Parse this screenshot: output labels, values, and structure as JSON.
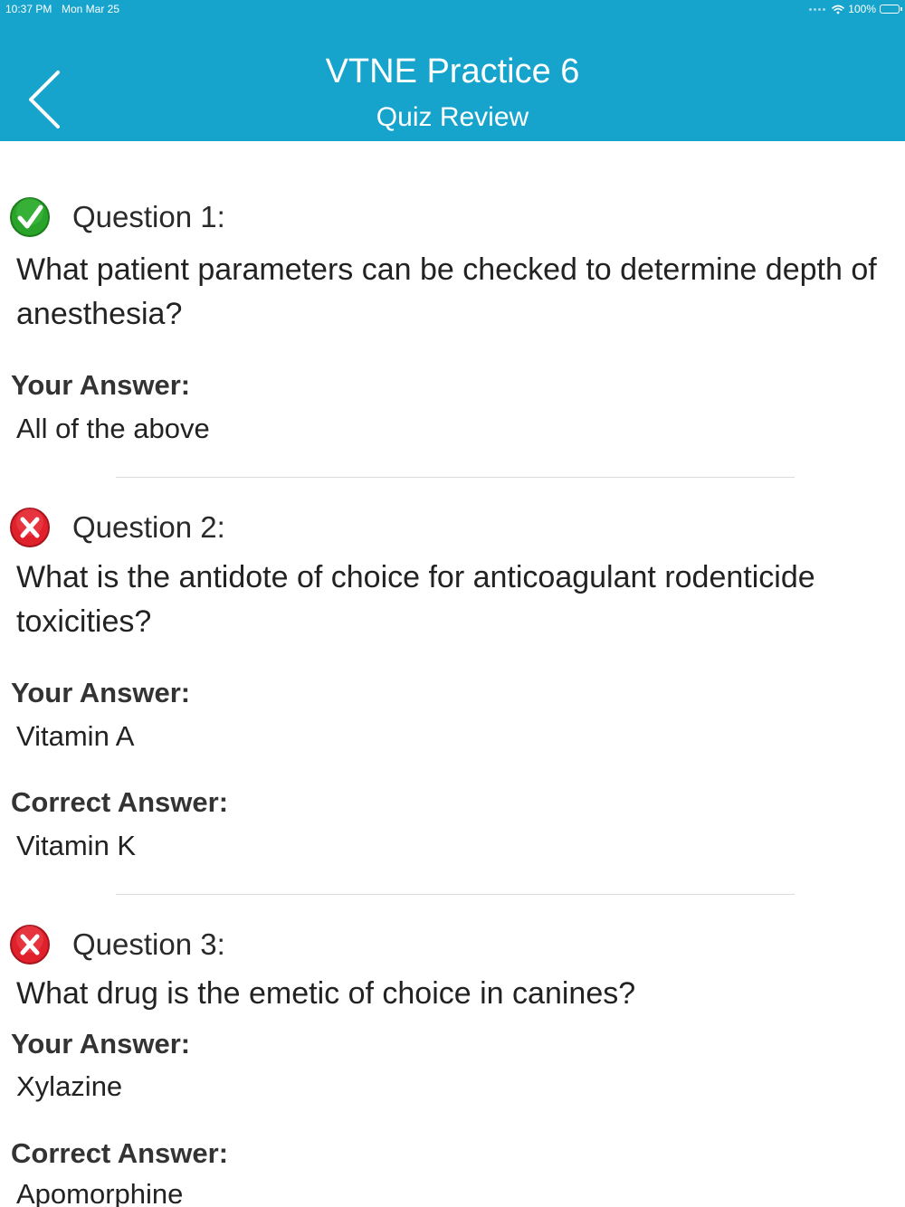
{
  "status_bar": {
    "time": "10:37 PM",
    "date": "Mon Mar 25",
    "battery": "100%",
    "battery_level": 1.0,
    "wifi_icon": "wifi-icon",
    "battery_icon": "battery-icon"
  },
  "nav": {
    "title": "VTNE Practice 6",
    "subtitle": "Quiz Review",
    "back_icon": "chevron-left-icon"
  },
  "colors": {
    "header": "#16a4cc",
    "correct": "#2aa32a",
    "incorrect": "#e0202b"
  },
  "questions": [
    {
      "label": "Question 1:",
      "status": "correct",
      "text": "What patient parameters can be checked to determine depth of anesthesia?",
      "your_answer_label": "Your Answer:",
      "your_answer": "All of the above"
    },
    {
      "label": "Question 2:",
      "status": "incorrect",
      "text": "What is the antidote of choice for anticoagulant rodenticide toxicities?",
      "your_answer_label": "Your Answer:",
      "your_answer": "Vitamin A",
      "correct_answer_label": "Correct Answer:",
      "correct_answer": "Vitamin K"
    },
    {
      "label": "Question 3:",
      "status": "incorrect",
      "text": "What drug is the emetic of choice in canines?",
      "your_answer_label": "Your Answer:",
      "your_answer": "Xylazine",
      "correct_answer_label": "Correct Answer:",
      "correct_answer": "Apomorphine"
    }
  ]
}
